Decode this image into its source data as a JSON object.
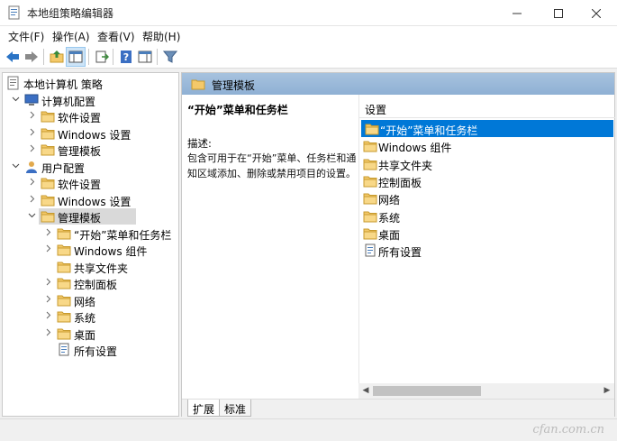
{
  "window": {
    "title": "本地组策略编辑器",
    "controls": [
      "minimize-icon",
      "maximize-icon",
      "close-icon"
    ]
  },
  "menu": [
    "文件(F)",
    "操作(A)",
    "查看(V)",
    "帮助(H)"
  ],
  "toolbar": {
    "buttons": [
      "back-arrow-icon",
      "forward-arrow-icon",
      "up-folder-icon",
      "show-hide-tree-icon",
      "export-list-icon",
      "help-icon",
      "console-icon",
      "filter-icon"
    ]
  },
  "tree": [
    {
      "label": "本地计算机 策略",
      "level": 0,
      "icon": "policy-icon",
      "chevron": ""
    },
    {
      "label": "计算机配置",
      "level": 1,
      "icon": "computer-icon",
      "chevron": "down"
    },
    {
      "label": "软件设置",
      "level": 2,
      "icon": "folder-icon",
      "chevron": "right"
    },
    {
      "label": "Windows 设置",
      "level": 2,
      "icon": "folder-icon",
      "chevron": "right"
    },
    {
      "label": "管理模板",
      "level": 2,
      "icon": "folder-icon",
      "chevron": "right"
    },
    {
      "label": "用户配置",
      "level": 1,
      "icon": "user-icon",
      "chevron": "down"
    },
    {
      "label": "软件设置",
      "level": 2,
      "icon": "folder-icon",
      "chevron": "right"
    },
    {
      "label": "Windows 设置",
      "level": 2,
      "icon": "folder-icon",
      "chevron": "right"
    },
    {
      "label": "管理模板",
      "level": 2,
      "icon": "folder-icon",
      "chevron": "down",
      "selected": true
    },
    {
      "label": "“开始”菜单和任务栏",
      "level": 3,
      "icon": "folder-icon",
      "chevron": "right"
    },
    {
      "label": "Windows 组件",
      "level": 3,
      "icon": "folder-icon",
      "chevron": "right"
    },
    {
      "label": "共享文件夹",
      "level": 3,
      "icon": "folder-icon",
      "chevron": ""
    },
    {
      "label": "控制面板",
      "level": 3,
      "icon": "folder-icon",
      "chevron": "right"
    },
    {
      "label": "网络",
      "level": 3,
      "icon": "folder-icon",
      "chevron": "right"
    },
    {
      "label": "系统",
      "level": 3,
      "icon": "folder-icon",
      "chevron": "right"
    },
    {
      "label": "桌面",
      "level": 3,
      "icon": "folder-icon",
      "chevron": "right"
    },
    {
      "label": "所有设置",
      "level": 3,
      "icon": "settings-list-icon",
      "chevron": ""
    }
  ],
  "right_pane": {
    "header": "管理模板",
    "description": {
      "title": "“开始”菜单和任务栏",
      "label": "描述:",
      "text": "包含可用于在“开始”菜单、任务栏和通知区域添加、删除或禁用项目的设置。"
    },
    "list_header": "设置",
    "items": [
      {
        "label": "“开始”菜单和任务栏",
        "icon": "folder-icon",
        "selected": true
      },
      {
        "label": "Windows 组件",
        "icon": "folder-icon"
      },
      {
        "label": "共享文件夹",
        "icon": "folder-icon"
      },
      {
        "label": "控制面板",
        "icon": "folder-icon"
      },
      {
        "label": "网络",
        "icon": "folder-icon"
      },
      {
        "label": "系统",
        "icon": "folder-icon"
      },
      {
        "label": "桌面",
        "icon": "folder-icon"
      },
      {
        "label": "所有设置",
        "icon": "settings-list-icon"
      }
    ],
    "tabs": [
      "扩展",
      "标准"
    ]
  },
  "watermark": "cfan.com.cn",
  "colors": {
    "selection": "#0078d7",
    "header_band": "#8fb4d9",
    "folder": "#f4c96a"
  }
}
